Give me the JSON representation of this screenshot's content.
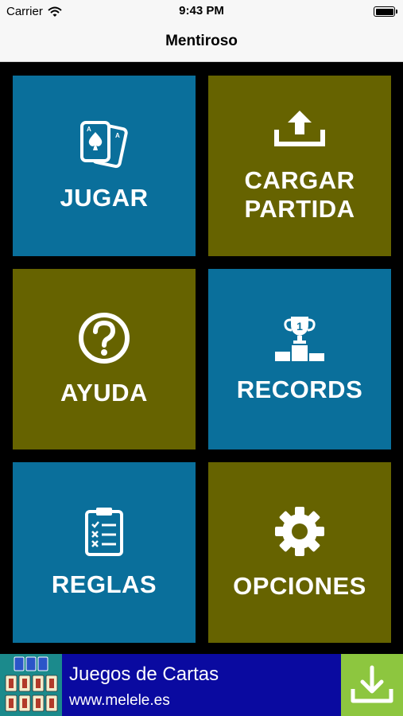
{
  "status_bar": {
    "carrier": "Carrier",
    "time": "9:43 PM"
  },
  "nav": {
    "title": "Mentiroso"
  },
  "menu": {
    "jugar": {
      "label": "JUGAR",
      "icon": "playing-cards-icon",
      "color": "#0a6f9b"
    },
    "cargar_partida": {
      "label_line1": "CARGAR",
      "label_line2": "PARTIDA",
      "icon": "upload-icon",
      "color": "#666300"
    },
    "ayuda": {
      "label": "AYUDA",
      "icon": "question-circle-icon",
      "color": "#666300"
    },
    "records": {
      "label": "RECORDS",
      "icon": "trophy-podium-icon",
      "color": "#0a6f9b"
    },
    "reglas": {
      "label": "REGLAS",
      "icon": "clipboard-checklist-icon",
      "color": "#0a6f9b"
    },
    "opciones": {
      "label": "OPCIONES",
      "icon": "gear-icon",
      "color": "#666300"
    }
  },
  "ad": {
    "title": "Juegos de Cartas",
    "url": "www.melele.es",
    "background": "#0a0aa0",
    "download_color": "#8dc63f"
  }
}
